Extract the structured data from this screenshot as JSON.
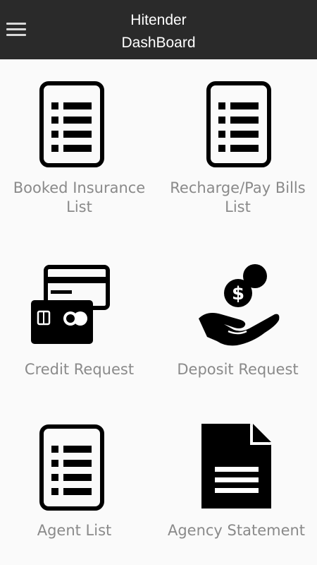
{
  "header": {
    "title_line1": "Hitender",
    "title_line2": "DashBoard"
  },
  "tiles": [
    {
      "label": "Booked Insurance List",
      "icon": "list-document-icon"
    },
    {
      "label": "Recharge/Pay Bills List",
      "icon": "list-document-icon"
    },
    {
      "label": "Credit Request",
      "icon": "credit-cards-icon"
    },
    {
      "label": "Deposit Request",
      "icon": "hand-money-icon"
    },
    {
      "label": "Agent List",
      "icon": "list-document-icon"
    },
    {
      "label": "Agency Statement",
      "icon": "file-document-icon"
    }
  ]
}
